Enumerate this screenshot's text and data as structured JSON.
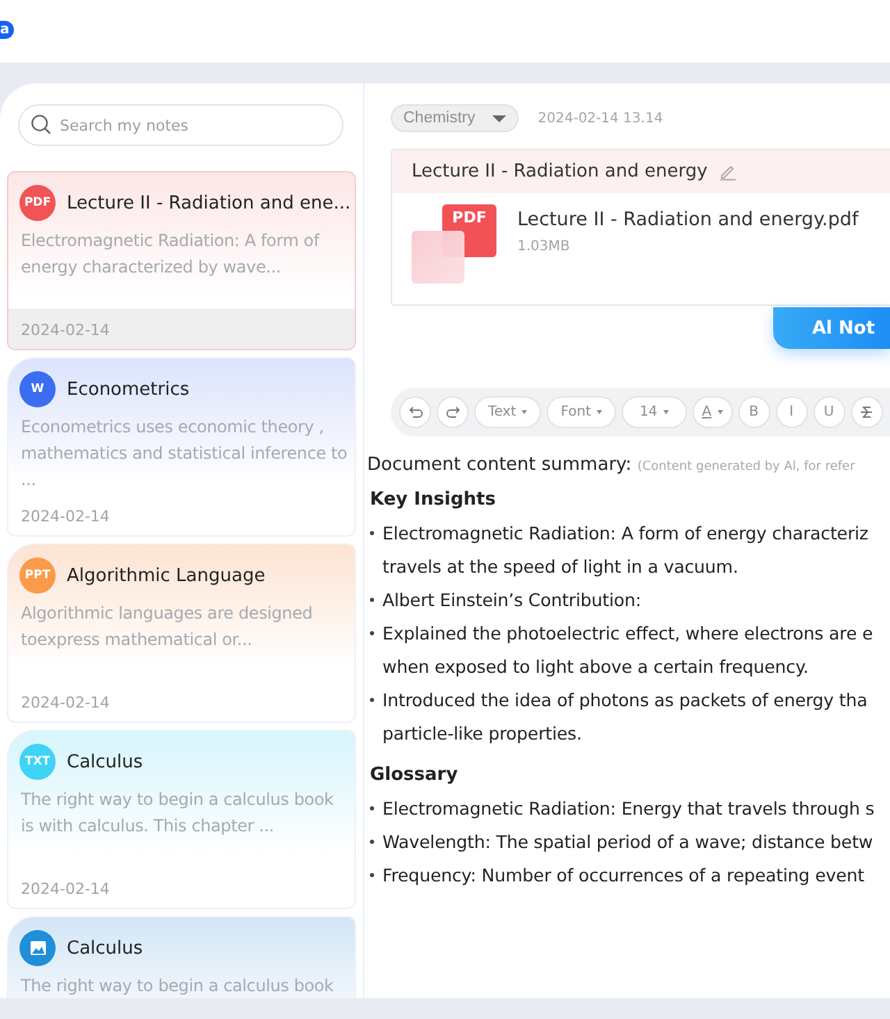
{
  "top_badge": "a",
  "search": {
    "placeholder": "Search my notes"
  },
  "notes": [
    {
      "kind": "pdf",
      "icon_label": "PDF",
      "color": "#f05454",
      "title": "Lecture II - Radiation and ene...",
      "preview": "Electromagnetic Radiation: A form of energy characterized by wave...",
      "date": "2024-02-14",
      "selected": true
    },
    {
      "kind": "word",
      "icon_label": "W",
      "color": "#3a6df0",
      "title": "Econometrics",
      "preview": "Econometrics uses economic theory , mathematics  and statistical inference to ...",
      "date": "2024-02-14",
      "selected": false
    },
    {
      "kind": "ppt",
      "icon_label": "PPT",
      "color": "#fb9a4a",
      "title": "Algorithmic Language",
      "preview": "Algorithmic languages are designed toexpress mathematical or...",
      "date": "2024-02-14",
      "selected": false
    },
    {
      "kind": "txt",
      "icon_label": "TXT",
      "color": "#3fd3f5",
      "title": "Calculus",
      "preview": "The right way to begin a calculus book is with calculus. This chapter ...",
      "date": "2024-02-14",
      "selected": false
    },
    {
      "kind": "image",
      "color": "#1e8fd8",
      "title": "Calculus",
      "preview": "The right way to begin a calculus book",
      "selected": false
    }
  ],
  "category": "Chemistry",
  "timestamp": "2024-02-14 13.14",
  "attachment": {
    "title": "Lecture II - Radiation and energy",
    "file_type": "PDF",
    "file_name": "Lecture II - Radiation and energy.pdf",
    "size": "1.03MB"
  },
  "ai_button": "Al Not",
  "toolbar": [
    {
      "kind": "undo"
    },
    {
      "kind": "redo"
    },
    {
      "kind": "dropdown",
      "label": "Text"
    },
    {
      "kind": "dropdown",
      "label": "Font"
    },
    {
      "kind": "dropdown",
      "label": "14"
    },
    {
      "kind": "color",
      "label": "A"
    },
    {
      "kind": "format",
      "label": "B"
    },
    {
      "kind": "format",
      "label": "I"
    },
    {
      "kind": "format",
      "label": "U"
    },
    {
      "kind": "strike"
    }
  ],
  "summary": {
    "label": "Document content summary:",
    "note": "(Content generated by Al, for refer"
  },
  "sections": [
    {
      "heading": "Key Insights",
      "bullets": [
        {
          "lines": [
            "Electromagnetic Radiation: A form of energy characteriz",
            "travels at the speed of light in a vacuum."
          ]
        },
        {
          "lines": [
            "Albert Einstein’s Contribution:"
          ]
        },
        {
          "lines": [
            "Explained the photoelectric effect, where electrons are e",
            "when exposed to light above a certain frequency."
          ]
        },
        {
          "lines": [
            "Introduced the idea of photons as packets of energy tha",
            "particle-like properties."
          ]
        }
      ]
    },
    {
      "heading": "Glossary",
      "bullets": [
        {
          "lines": [
            "Electromagnetic Radiation: Energy that travels through s"
          ]
        },
        {
          "lines": [
            "Wavelength: The spatial period of a wave; distance betw"
          ]
        },
        {
          "lines": [
            "Frequency: Number of occurrences of a repeating event"
          ]
        }
      ]
    }
  ]
}
